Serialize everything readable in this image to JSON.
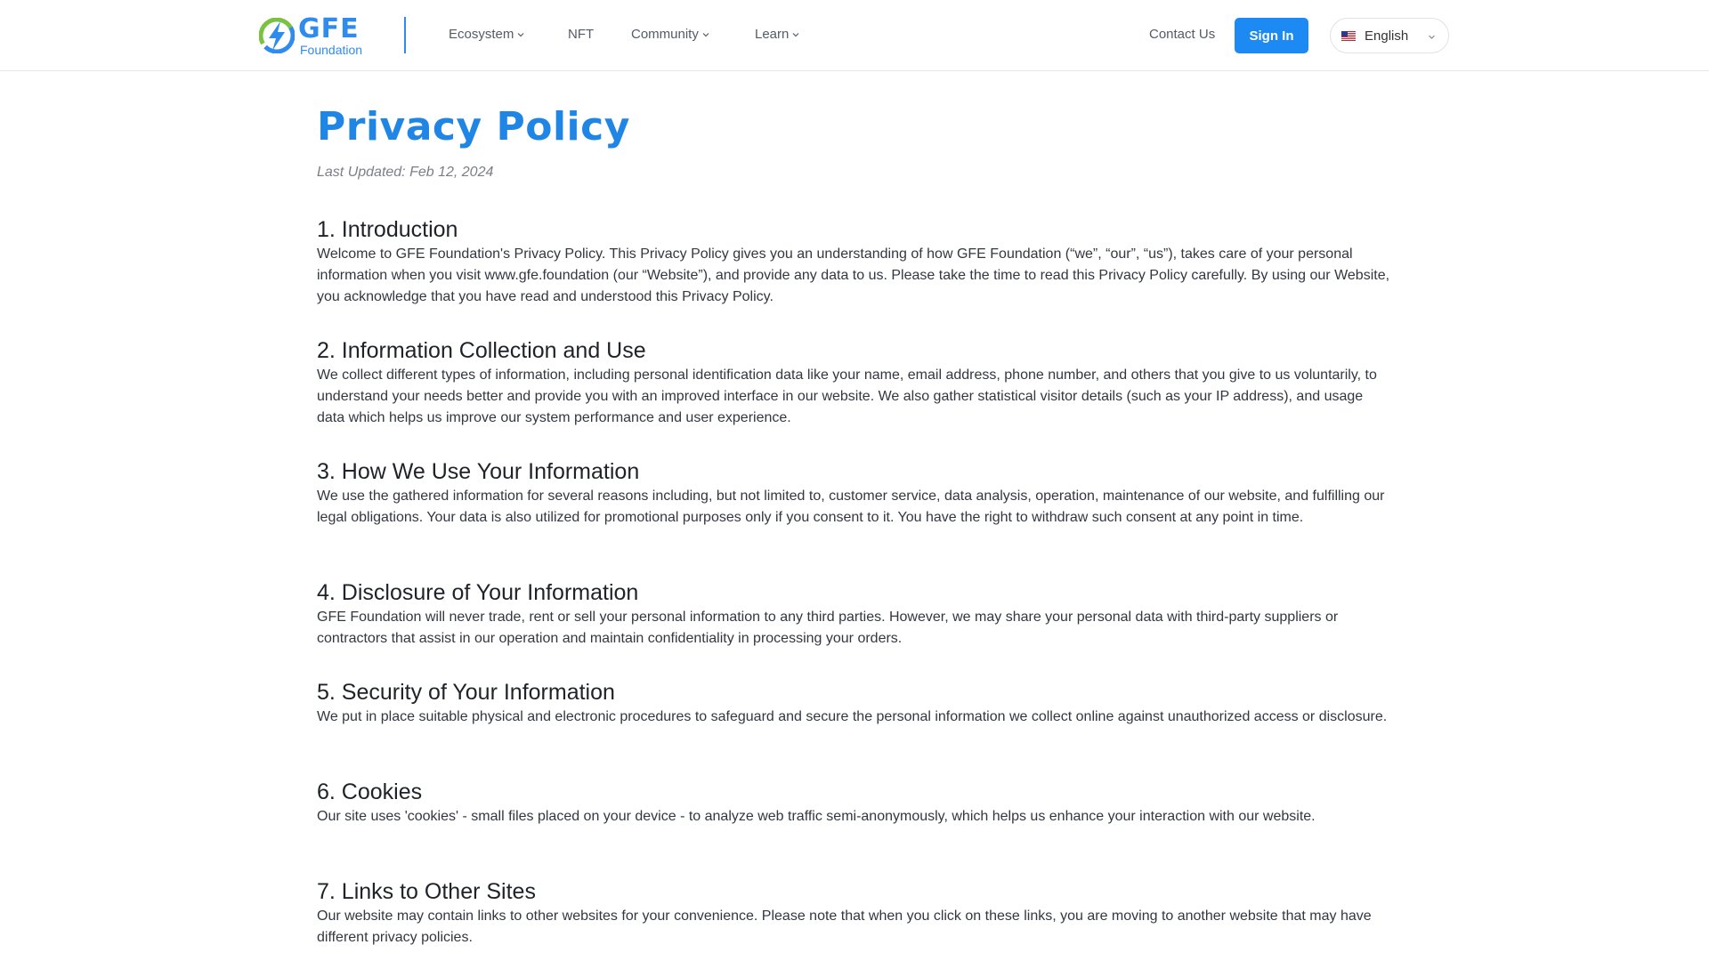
{
  "brand": {
    "name": "GFE",
    "subname": "Foundation",
    "accent": "#2f8bee"
  },
  "nav": {
    "items": [
      {
        "label": "Ecosystem",
        "dropdown": true
      },
      {
        "label": "NFT",
        "dropdown": false
      },
      {
        "label": "Community",
        "dropdown": true
      },
      {
        "label": "Learn",
        "dropdown": true
      }
    ],
    "contact_label": "Contact Us",
    "signin_label": "Sign In",
    "language": {
      "selected": "English",
      "flag_icon": "us-flag-icon"
    }
  },
  "page": {
    "title": "Privacy Policy",
    "last_updated": "Last Updated: Feb 12, 2024",
    "sections": [
      {
        "title": "1. Introduction",
        "body": "Welcome to GFE Foundation's Privacy Policy. This Privacy Policy gives you an understanding of how GFE Foundation (“we”, “our”, “us”), takes care of your personal information when you visit www.gfe.foundation (our “Website”), and provide any data to us. Please take the time to read this Privacy Policy carefully. By using our Website, you acknowledge that you have read and understood this Privacy Policy."
      },
      {
        "title": "2. Information Collection and Use",
        "body": "We collect different types of information, including personal identification data like your name, email address, phone number, and others that you give to us voluntarily, to understand your needs better and provide you with an improved interface in our website. We also gather statistical visitor details (such as your IP address), and usage data which helps us improve our system performance and user experience."
      },
      {
        "title": "3. How We Use Your Information",
        "body": "We use the gathered information for several reasons including, but not limited to, customer service, data analysis, operation, maintenance of our website, and fulfilling our legal obligations. Your data is also utilized for promotional purposes only if you consent to it. You have the right to withdraw such consent at any point in time."
      },
      {
        "title": "4. Disclosure of Your Information",
        "body": "GFE Foundation will never trade, rent or sell your personal information to any third parties. However, we may share your personal data with third-party suppliers or contractors that assist in our operation and maintain confidentiality in processing your orders."
      },
      {
        "title": "5. Security of Your Information",
        "body": "We put in place suitable physical and electronic procedures to safeguard and secure the personal information we collect online against unauthorized access or disclosure."
      },
      {
        "title": "6. Cookies",
        "body": "Our site uses 'cookies' - small files placed on your device - to analyze web traffic semi-anonymously, which helps us enhance your interaction with our website."
      },
      {
        "title": "7. Links to Other Sites",
        "body": "Our website may contain links to other websites for your convenience. Please note that when you click on these links, you are moving to another website that may have different privacy policies."
      }
    ]
  }
}
